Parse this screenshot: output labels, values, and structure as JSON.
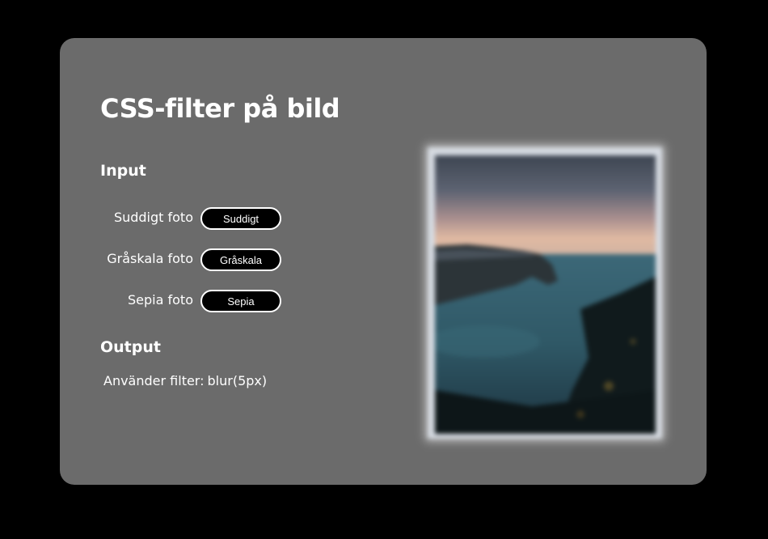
{
  "title": "CSS-filter på bild",
  "input": {
    "heading": "Input",
    "filters": [
      {
        "label": "Suddigt foto",
        "button": "Suddigt"
      },
      {
        "label": "Gråskala foto",
        "button": "Gråskala"
      },
      {
        "label": "Sepia foto",
        "button": "Sepia"
      }
    ]
  },
  "output": {
    "heading": "Output",
    "prefix": "Använder filter:",
    "value": "blur(5px)"
  },
  "colors": {
    "page_background": "#000000",
    "card_background": "#6b6b6b",
    "button_background": "#000000",
    "text": "#ffffff"
  }
}
